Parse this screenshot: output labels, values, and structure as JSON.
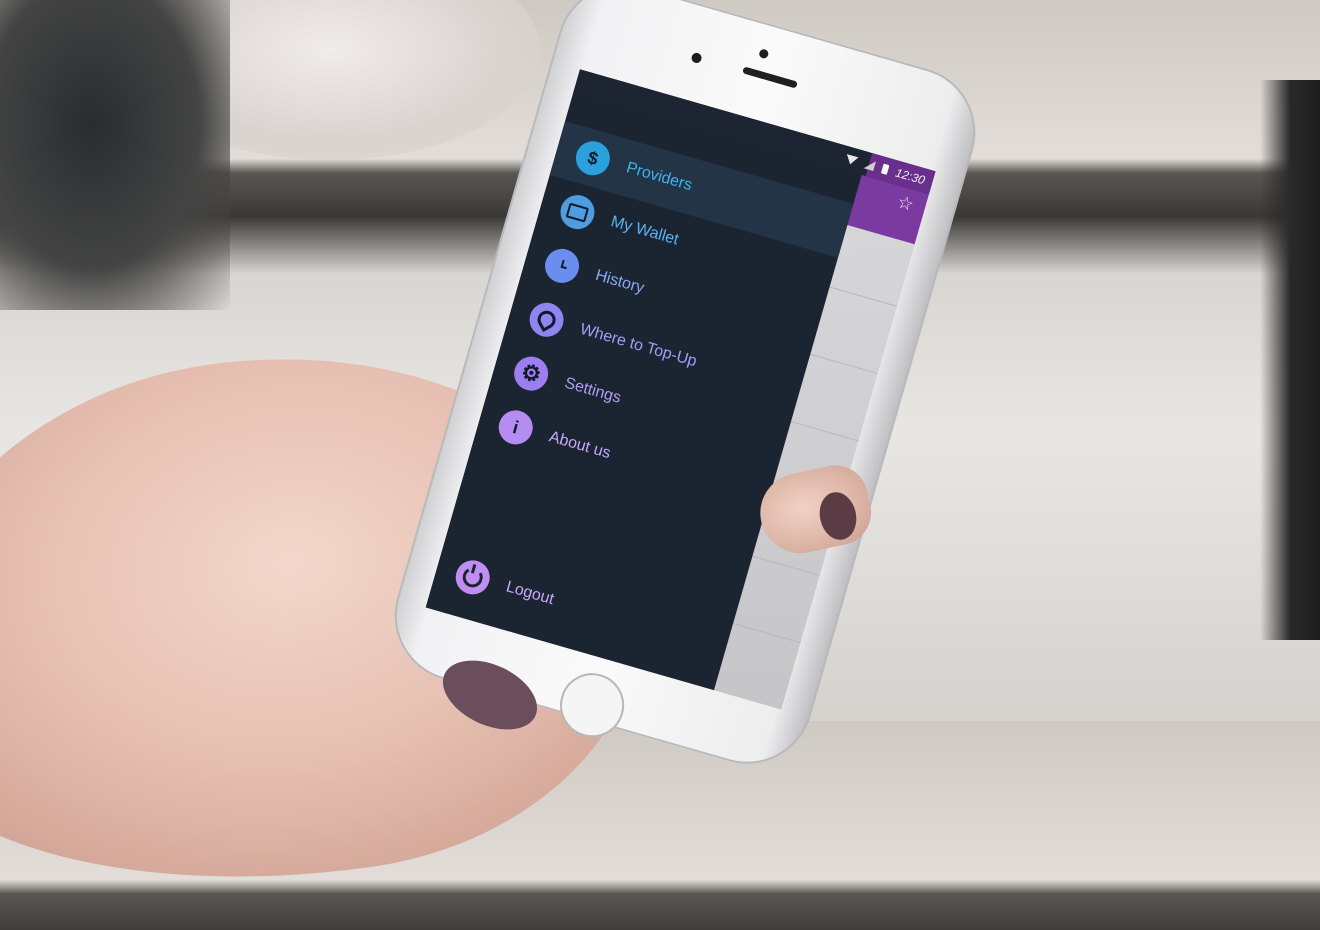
{
  "statusbar": {
    "time": "12:30"
  },
  "appbar": {
    "star_icon": "star-icon",
    "accent": "#7a3aa0"
  },
  "drawer": {
    "background": "#1b2532",
    "items": [
      {
        "label": "Providers",
        "icon": "dollar-icon",
        "glyph": "$",
        "active": true
      },
      {
        "label": "My Wallet",
        "icon": "wallet-icon",
        "glyph": ""
      },
      {
        "label": "History",
        "icon": "clock-icon",
        "glyph": ""
      },
      {
        "label": "Where to Top-Up",
        "icon": "location-pin-icon",
        "glyph": ""
      },
      {
        "label": "Settings",
        "icon": "gear-icon",
        "glyph": "⚙"
      },
      {
        "label": "About us",
        "icon": "info-icon",
        "glyph": "i"
      }
    ],
    "logout": {
      "label": "Logout",
      "icon": "power-icon"
    }
  }
}
